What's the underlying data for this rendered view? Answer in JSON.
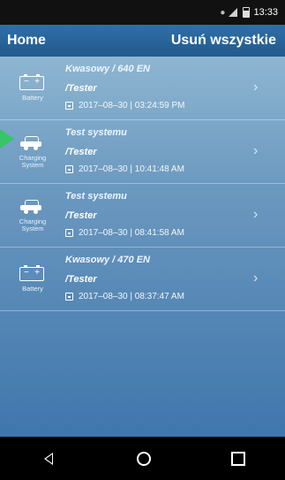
{
  "status": {
    "time": "13:33"
  },
  "header": {
    "title": "Home",
    "action": "Usuń wszystkie"
  },
  "items": [
    {
      "type_label": "Battery",
      "icon": "battery-icon",
      "name": "Kwasowy / 640 EN",
      "tester": "/Tester",
      "date": "2017–08–30 | 03:24:59 PM"
    },
    {
      "type_label": "Charging\nSystem",
      "icon": "car-icon",
      "name": "Test systemu",
      "tester": "/Tester",
      "date": "2017–08–30 | 10:41:48 AM"
    },
    {
      "type_label": "Charging\nSystem",
      "icon": "car-icon",
      "name": "Test systemu",
      "tester": "/Tester",
      "date": "2017–08–30 | 08:41:58 AM"
    },
    {
      "type_label": "Battery",
      "icon": "battery-icon",
      "name": "Kwasowy / 470 EN",
      "tester": "/Tester",
      "date": "2017–08–30 | 08:37:47 AM"
    }
  ],
  "colors": {
    "header": "#2f6fa8",
    "list_top": "#8eb6d2",
    "list_bottom": "#3f76ac",
    "accent": "#38c46a"
  }
}
